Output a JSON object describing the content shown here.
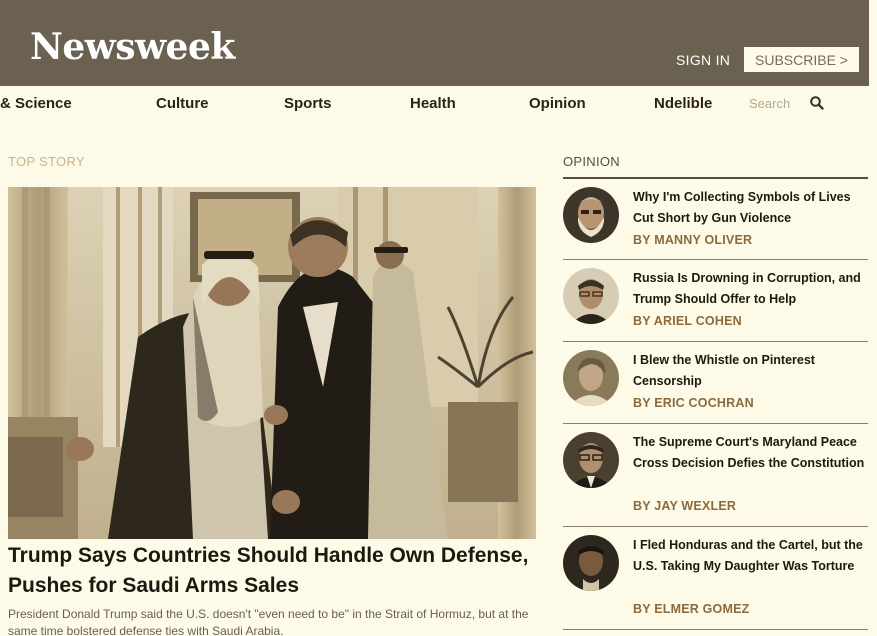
{
  "header": {
    "logo": "Newsweek",
    "sign_in": "SIGN IN",
    "subscribe": "SUBSCRIBE >"
  },
  "nav": {
    "items": [
      "& Science",
      "Culture",
      "Sports",
      "Health",
      "Opinion",
      "Ndelible"
    ],
    "search_placeholder": "Search"
  },
  "top_story": {
    "section": "TOP STORY",
    "headline": "Trump Says Countries Should Handle Own Defense, Pushes for Saudi Arms Sales",
    "dek": "President Donald Trump said the U.S. doesn't \"even need to be\" in the Strait of Hormuz, but at the same time bolstered defense ties with Saudi Arabia."
  },
  "opinion": {
    "section": "OPINION",
    "items": [
      {
        "title": "Why I'm Collecting Symbols of Lives Cut Short by Gun Violence",
        "byline": "BY MANNY OLIVER"
      },
      {
        "title": "Russia Is Drowning in Corruption, and Trump Should Offer to Help",
        "byline": "BY ARIEL COHEN"
      },
      {
        "title": "I Blew the Whistle on Pinterest Censorship",
        "byline": "BY ERIC COCHRAN"
      },
      {
        "title": "The Supreme Court's Maryland Peace Cross Decision Defies the Constitution",
        "byline": "BY JAY WEXLER"
      },
      {
        "title": "I Fled Honduras and the Cartel, but the U.S. Taking My Daughter Was Torture",
        "byline": "BY ELMER GOMEZ"
      }
    ]
  },
  "colors": {
    "header_bg": "#6b6150",
    "page_bg": "#fdfbe8",
    "byline": "#8a6a3e",
    "section_label": "#c9b48a"
  }
}
